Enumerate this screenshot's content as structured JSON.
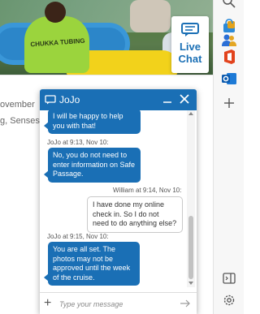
{
  "page": {
    "hero_shirt_text": "CHUKKA TUBING",
    "live_chat_label_1": "Live",
    "live_chat_label_2": "Chat",
    "text_line_1": "ovember",
    "text_line_2": "g, Senses"
  },
  "chat": {
    "title": "JoJo",
    "input_placeholder": "Type your message",
    "messages": [
      {
        "sender": "agent",
        "text": "I will be happy to help you with that!"
      },
      {
        "meta": "JoJo at 9:13, Nov 10:"
      },
      {
        "sender": "agent",
        "text": "No, you do not need to enter information on Safe Passage."
      },
      {
        "meta": "William at 9:14, Nov 10:"
      },
      {
        "sender": "user",
        "text": "I have done my online check in. So I do not need to do anything else?"
      },
      {
        "meta": "JoJo at 9:15, Nov 10:"
      },
      {
        "sender": "agent",
        "text": "You are all set. The photos may not be approved until the week of the cruise."
      }
    ]
  },
  "colors": {
    "accent": "#1a6fb5"
  },
  "sidebar": {
    "icons": [
      "search-icon",
      "bag-icon",
      "people-icon",
      "office-icon",
      "outlook-icon",
      "add-icon",
      "panel-icon",
      "settings-icon"
    ]
  }
}
